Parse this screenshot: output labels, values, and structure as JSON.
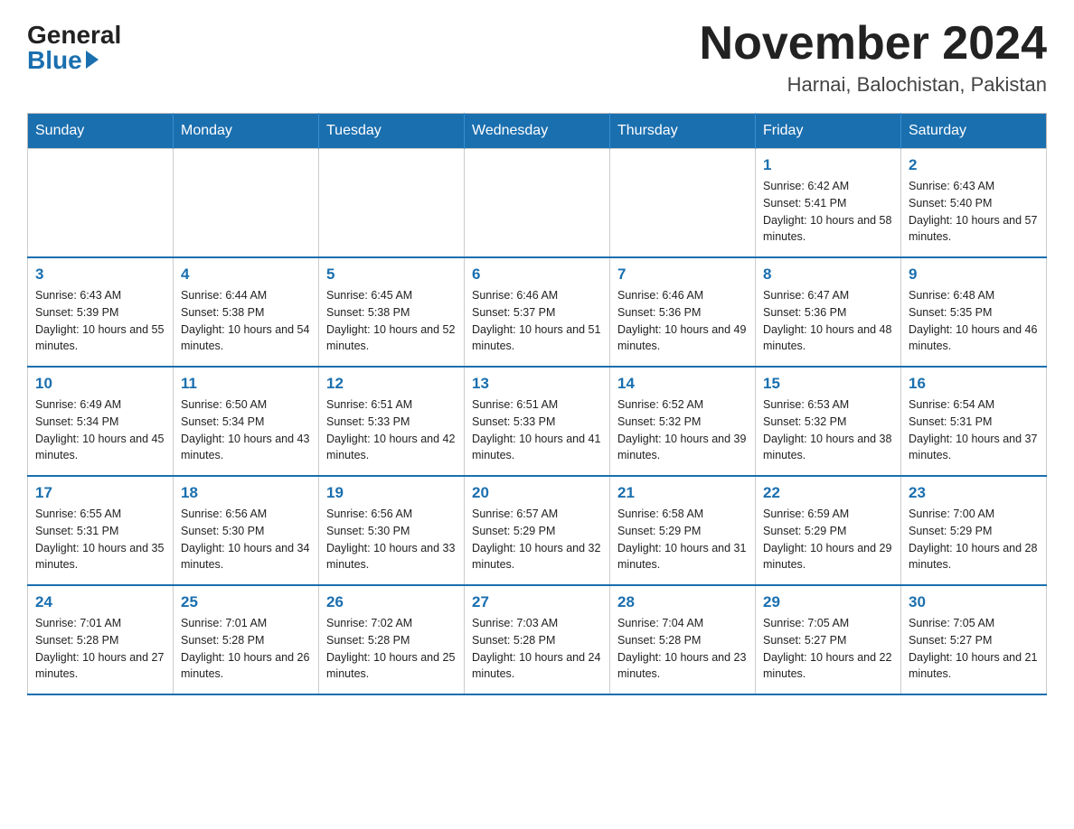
{
  "header": {
    "logo_general": "General",
    "logo_blue": "Blue",
    "title": "November 2024",
    "subtitle": "Harnai, Balochistan, Pakistan"
  },
  "calendar": {
    "days": [
      "Sunday",
      "Monday",
      "Tuesday",
      "Wednesday",
      "Thursday",
      "Friday",
      "Saturday"
    ],
    "weeks": [
      [
        {
          "date": "",
          "sunrise": "",
          "sunset": "",
          "daylight": ""
        },
        {
          "date": "",
          "sunrise": "",
          "sunset": "",
          "daylight": ""
        },
        {
          "date": "",
          "sunrise": "",
          "sunset": "",
          "daylight": ""
        },
        {
          "date": "",
          "sunrise": "",
          "sunset": "",
          "daylight": ""
        },
        {
          "date": "",
          "sunrise": "",
          "sunset": "",
          "daylight": ""
        },
        {
          "date": "1",
          "sunrise": "Sunrise: 6:42 AM",
          "sunset": "Sunset: 5:41 PM",
          "daylight": "Daylight: 10 hours and 58 minutes."
        },
        {
          "date": "2",
          "sunrise": "Sunrise: 6:43 AM",
          "sunset": "Sunset: 5:40 PM",
          "daylight": "Daylight: 10 hours and 57 minutes."
        }
      ],
      [
        {
          "date": "3",
          "sunrise": "Sunrise: 6:43 AM",
          "sunset": "Sunset: 5:39 PM",
          "daylight": "Daylight: 10 hours and 55 minutes."
        },
        {
          "date": "4",
          "sunrise": "Sunrise: 6:44 AM",
          "sunset": "Sunset: 5:38 PM",
          "daylight": "Daylight: 10 hours and 54 minutes."
        },
        {
          "date": "5",
          "sunrise": "Sunrise: 6:45 AM",
          "sunset": "Sunset: 5:38 PM",
          "daylight": "Daylight: 10 hours and 52 minutes."
        },
        {
          "date": "6",
          "sunrise": "Sunrise: 6:46 AM",
          "sunset": "Sunset: 5:37 PM",
          "daylight": "Daylight: 10 hours and 51 minutes."
        },
        {
          "date": "7",
          "sunrise": "Sunrise: 6:46 AM",
          "sunset": "Sunset: 5:36 PM",
          "daylight": "Daylight: 10 hours and 49 minutes."
        },
        {
          "date": "8",
          "sunrise": "Sunrise: 6:47 AM",
          "sunset": "Sunset: 5:36 PM",
          "daylight": "Daylight: 10 hours and 48 minutes."
        },
        {
          "date": "9",
          "sunrise": "Sunrise: 6:48 AM",
          "sunset": "Sunset: 5:35 PM",
          "daylight": "Daylight: 10 hours and 46 minutes."
        }
      ],
      [
        {
          "date": "10",
          "sunrise": "Sunrise: 6:49 AM",
          "sunset": "Sunset: 5:34 PM",
          "daylight": "Daylight: 10 hours and 45 minutes."
        },
        {
          "date": "11",
          "sunrise": "Sunrise: 6:50 AM",
          "sunset": "Sunset: 5:34 PM",
          "daylight": "Daylight: 10 hours and 43 minutes."
        },
        {
          "date": "12",
          "sunrise": "Sunrise: 6:51 AM",
          "sunset": "Sunset: 5:33 PM",
          "daylight": "Daylight: 10 hours and 42 minutes."
        },
        {
          "date": "13",
          "sunrise": "Sunrise: 6:51 AM",
          "sunset": "Sunset: 5:33 PM",
          "daylight": "Daylight: 10 hours and 41 minutes."
        },
        {
          "date": "14",
          "sunrise": "Sunrise: 6:52 AM",
          "sunset": "Sunset: 5:32 PM",
          "daylight": "Daylight: 10 hours and 39 minutes."
        },
        {
          "date": "15",
          "sunrise": "Sunrise: 6:53 AM",
          "sunset": "Sunset: 5:32 PM",
          "daylight": "Daylight: 10 hours and 38 minutes."
        },
        {
          "date": "16",
          "sunrise": "Sunrise: 6:54 AM",
          "sunset": "Sunset: 5:31 PM",
          "daylight": "Daylight: 10 hours and 37 minutes."
        }
      ],
      [
        {
          "date": "17",
          "sunrise": "Sunrise: 6:55 AM",
          "sunset": "Sunset: 5:31 PM",
          "daylight": "Daylight: 10 hours and 35 minutes."
        },
        {
          "date": "18",
          "sunrise": "Sunrise: 6:56 AM",
          "sunset": "Sunset: 5:30 PM",
          "daylight": "Daylight: 10 hours and 34 minutes."
        },
        {
          "date": "19",
          "sunrise": "Sunrise: 6:56 AM",
          "sunset": "Sunset: 5:30 PM",
          "daylight": "Daylight: 10 hours and 33 minutes."
        },
        {
          "date": "20",
          "sunrise": "Sunrise: 6:57 AM",
          "sunset": "Sunset: 5:29 PM",
          "daylight": "Daylight: 10 hours and 32 minutes."
        },
        {
          "date": "21",
          "sunrise": "Sunrise: 6:58 AM",
          "sunset": "Sunset: 5:29 PM",
          "daylight": "Daylight: 10 hours and 31 minutes."
        },
        {
          "date": "22",
          "sunrise": "Sunrise: 6:59 AM",
          "sunset": "Sunset: 5:29 PM",
          "daylight": "Daylight: 10 hours and 29 minutes."
        },
        {
          "date": "23",
          "sunrise": "Sunrise: 7:00 AM",
          "sunset": "Sunset: 5:29 PM",
          "daylight": "Daylight: 10 hours and 28 minutes."
        }
      ],
      [
        {
          "date": "24",
          "sunrise": "Sunrise: 7:01 AM",
          "sunset": "Sunset: 5:28 PM",
          "daylight": "Daylight: 10 hours and 27 minutes."
        },
        {
          "date": "25",
          "sunrise": "Sunrise: 7:01 AM",
          "sunset": "Sunset: 5:28 PM",
          "daylight": "Daylight: 10 hours and 26 minutes."
        },
        {
          "date": "26",
          "sunrise": "Sunrise: 7:02 AM",
          "sunset": "Sunset: 5:28 PM",
          "daylight": "Daylight: 10 hours and 25 minutes."
        },
        {
          "date": "27",
          "sunrise": "Sunrise: 7:03 AM",
          "sunset": "Sunset: 5:28 PM",
          "daylight": "Daylight: 10 hours and 24 minutes."
        },
        {
          "date": "28",
          "sunrise": "Sunrise: 7:04 AM",
          "sunset": "Sunset: 5:28 PM",
          "daylight": "Daylight: 10 hours and 23 minutes."
        },
        {
          "date": "29",
          "sunrise": "Sunrise: 7:05 AM",
          "sunset": "Sunset: 5:27 PM",
          "daylight": "Daylight: 10 hours and 22 minutes."
        },
        {
          "date": "30",
          "sunrise": "Sunrise: 7:05 AM",
          "sunset": "Sunset: 5:27 PM",
          "daylight": "Daylight: 10 hours and 21 minutes."
        }
      ]
    ]
  }
}
